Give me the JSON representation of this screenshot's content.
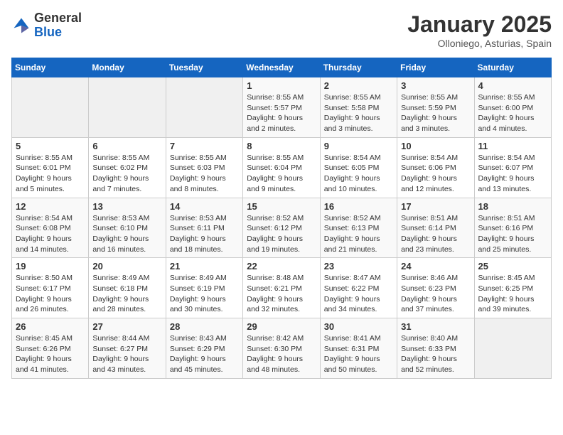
{
  "header": {
    "logo_general": "General",
    "logo_blue": "Blue",
    "title": "January 2025",
    "subtitle": "Olloniego, Asturias, Spain"
  },
  "weekdays": [
    "Sunday",
    "Monday",
    "Tuesday",
    "Wednesday",
    "Thursday",
    "Friday",
    "Saturday"
  ],
  "weeks": [
    [
      {
        "day": "",
        "detail": ""
      },
      {
        "day": "",
        "detail": ""
      },
      {
        "day": "",
        "detail": ""
      },
      {
        "day": "1",
        "detail": "Sunrise: 8:55 AM\nSunset: 5:57 PM\nDaylight: 9 hours\nand 2 minutes."
      },
      {
        "day": "2",
        "detail": "Sunrise: 8:55 AM\nSunset: 5:58 PM\nDaylight: 9 hours\nand 3 minutes."
      },
      {
        "day": "3",
        "detail": "Sunrise: 8:55 AM\nSunset: 5:59 PM\nDaylight: 9 hours\nand 3 minutes."
      },
      {
        "day": "4",
        "detail": "Sunrise: 8:55 AM\nSunset: 6:00 PM\nDaylight: 9 hours\nand 4 minutes."
      }
    ],
    [
      {
        "day": "5",
        "detail": "Sunrise: 8:55 AM\nSunset: 6:01 PM\nDaylight: 9 hours\nand 5 minutes."
      },
      {
        "day": "6",
        "detail": "Sunrise: 8:55 AM\nSunset: 6:02 PM\nDaylight: 9 hours\nand 7 minutes."
      },
      {
        "day": "7",
        "detail": "Sunrise: 8:55 AM\nSunset: 6:03 PM\nDaylight: 9 hours\nand 8 minutes."
      },
      {
        "day": "8",
        "detail": "Sunrise: 8:55 AM\nSunset: 6:04 PM\nDaylight: 9 hours\nand 9 minutes."
      },
      {
        "day": "9",
        "detail": "Sunrise: 8:54 AM\nSunset: 6:05 PM\nDaylight: 9 hours\nand 10 minutes."
      },
      {
        "day": "10",
        "detail": "Sunrise: 8:54 AM\nSunset: 6:06 PM\nDaylight: 9 hours\nand 12 minutes."
      },
      {
        "day": "11",
        "detail": "Sunrise: 8:54 AM\nSunset: 6:07 PM\nDaylight: 9 hours\nand 13 minutes."
      }
    ],
    [
      {
        "day": "12",
        "detail": "Sunrise: 8:54 AM\nSunset: 6:08 PM\nDaylight: 9 hours\nand 14 minutes."
      },
      {
        "day": "13",
        "detail": "Sunrise: 8:53 AM\nSunset: 6:10 PM\nDaylight: 9 hours\nand 16 minutes."
      },
      {
        "day": "14",
        "detail": "Sunrise: 8:53 AM\nSunset: 6:11 PM\nDaylight: 9 hours\nand 18 minutes."
      },
      {
        "day": "15",
        "detail": "Sunrise: 8:52 AM\nSunset: 6:12 PM\nDaylight: 9 hours\nand 19 minutes."
      },
      {
        "day": "16",
        "detail": "Sunrise: 8:52 AM\nSunset: 6:13 PM\nDaylight: 9 hours\nand 21 minutes."
      },
      {
        "day": "17",
        "detail": "Sunrise: 8:51 AM\nSunset: 6:14 PM\nDaylight: 9 hours\nand 23 minutes."
      },
      {
        "day": "18",
        "detail": "Sunrise: 8:51 AM\nSunset: 6:16 PM\nDaylight: 9 hours\nand 25 minutes."
      }
    ],
    [
      {
        "day": "19",
        "detail": "Sunrise: 8:50 AM\nSunset: 6:17 PM\nDaylight: 9 hours\nand 26 minutes."
      },
      {
        "day": "20",
        "detail": "Sunrise: 8:49 AM\nSunset: 6:18 PM\nDaylight: 9 hours\nand 28 minutes."
      },
      {
        "day": "21",
        "detail": "Sunrise: 8:49 AM\nSunset: 6:19 PM\nDaylight: 9 hours\nand 30 minutes."
      },
      {
        "day": "22",
        "detail": "Sunrise: 8:48 AM\nSunset: 6:21 PM\nDaylight: 9 hours\nand 32 minutes."
      },
      {
        "day": "23",
        "detail": "Sunrise: 8:47 AM\nSunset: 6:22 PM\nDaylight: 9 hours\nand 34 minutes."
      },
      {
        "day": "24",
        "detail": "Sunrise: 8:46 AM\nSunset: 6:23 PM\nDaylight: 9 hours\nand 37 minutes."
      },
      {
        "day": "25",
        "detail": "Sunrise: 8:45 AM\nSunset: 6:25 PM\nDaylight: 9 hours\nand 39 minutes."
      }
    ],
    [
      {
        "day": "26",
        "detail": "Sunrise: 8:45 AM\nSunset: 6:26 PM\nDaylight: 9 hours\nand 41 minutes."
      },
      {
        "day": "27",
        "detail": "Sunrise: 8:44 AM\nSunset: 6:27 PM\nDaylight: 9 hours\nand 43 minutes."
      },
      {
        "day": "28",
        "detail": "Sunrise: 8:43 AM\nSunset: 6:29 PM\nDaylight: 9 hours\nand 45 minutes."
      },
      {
        "day": "29",
        "detail": "Sunrise: 8:42 AM\nSunset: 6:30 PM\nDaylight: 9 hours\nand 48 minutes."
      },
      {
        "day": "30",
        "detail": "Sunrise: 8:41 AM\nSunset: 6:31 PM\nDaylight: 9 hours\nand 50 minutes."
      },
      {
        "day": "31",
        "detail": "Sunrise: 8:40 AM\nSunset: 6:33 PM\nDaylight: 9 hours\nand 52 minutes."
      },
      {
        "day": "",
        "detail": ""
      }
    ]
  ]
}
